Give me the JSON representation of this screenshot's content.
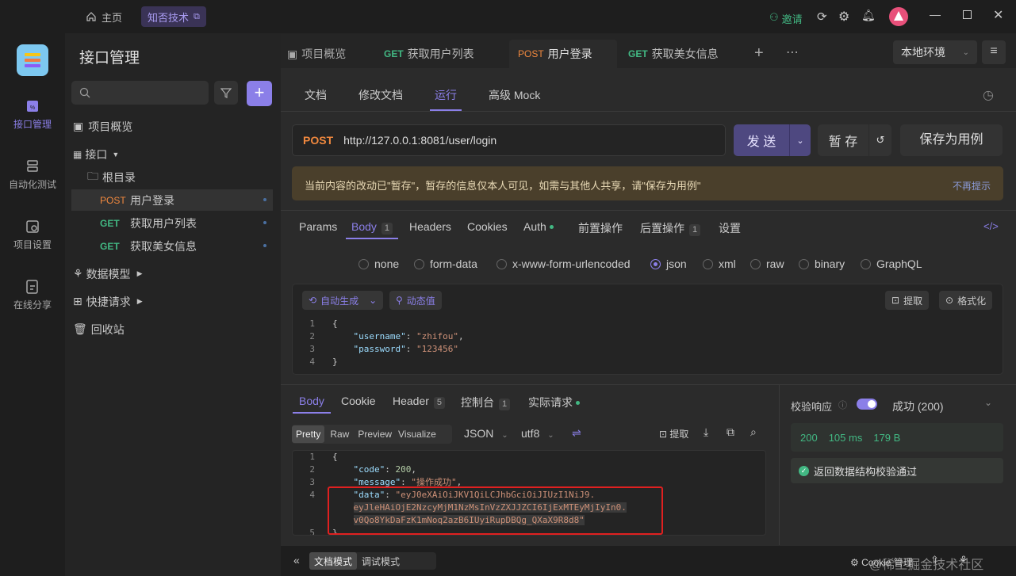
{
  "topbar": {
    "home": "主页",
    "tab": "知否技术",
    "invite": "邀请"
  },
  "rail": [
    "接口管理",
    "自动化测试",
    "项目设置",
    "在线分享"
  ],
  "sidebar": {
    "title": "接口管理",
    "items": [
      {
        "label": "项目概览"
      },
      {
        "label": "接口"
      },
      {
        "label": "根目录"
      },
      {
        "method": "POST",
        "label": "用户登录"
      },
      {
        "method": "GET",
        "label": "获取用户列表"
      },
      {
        "method": "GET",
        "label": "获取美女信息"
      },
      {
        "label": "数据模型"
      },
      {
        "label": "快捷请求"
      },
      {
        "label": "回收站"
      }
    ]
  },
  "tabs": [
    {
      "label": "项目概览"
    },
    {
      "method": "GET",
      "label": "获取用户列表"
    },
    {
      "method": "POST",
      "label": "用户登录"
    },
    {
      "method": "GET",
      "label": "获取美女信息"
    }
  ],
  "env": "本地环境",
  "subtabs": [
    "文档",
    "修改文档",
    "运行",
    "高级 Mock"
  ],
  "request": {
    "method": "POST",
    "url": "http://127.0.0.1:8081/user/login",
    "send": "发 送",
    "save": "暂 存",
    "save_case": "保存为用例"
  },
  "notice": {
    "text": "当前内容的改动已\"暂存\"，暂存的信息仅本人可见，如需与其他人共享，请\"保存为用例\"",
    "dismiss": "不再提示"
  },
  "param_tabs": {
    "params": "Params",
    "body": "Body",
    "body_count": "1",
    "headers": "Headers",
    "cookies": "Cookies",
    "auth": "Auth",
    "pre": "前置操作",
    "post": "后置操作",
    "post_count": "1",
    "settings": "设置"
  },
  "body_types": [
    "none",
    "form-data",
    "x-www-form-urlencoded",
    "json",
    "xml",
    "raw",
    "binary",
    "GraphQL"
  ],
  "editor": {
    "autogen": "自动生成",
    "dynamic": "动态值",
    "extract": "提取",
    "format": "格式化"
  },
  "request_body": {
    "l2k": "\"username\"",
    "l2v": "\"zhifou\"",
    "l3k": "\"password\"",
    "l3v": "\"123456\""
  },
  "resp_tabs": {
    "body": "Body",
    "cookie": "Cookie",
    "header": "Header",
    "header_count": "5",
    "console": "控制台",
    "console_count": "1",
    "actual": "实际请求"
  },
  "resp_toolbar": {
    "pretty": "Pretty",
    "raw": "Raw",
    "preview": "Preview",
    "visualize": "Visualize",
    "format": "JSON",
    "encoding": "utf8",
    "extract": "提取"
  },
  "response_body": {
    "code_k": "\"code\"",
    "code_v": "200",
    "msg_k": "\"message\"",
    "msg_v": "\"操作成功\"",
    "data_k": "\"data\"",
    "data_1": "\"eyJ0eXAiOiJKV1QiLCJhbGciOiJIUzI1NiJ9.",
    "data_2": "eyJleHAiOjE2NzcyMjM1NzMsInVzZXJJZCI6IjExMTEyMjIyIn0.",
    "data_3": "v0Qo8YkDaFzK1mNoq2azB6IUyiRupDBQg_QXaX9R8d8\""
  },
  "validate": {
    "label": "校验响应",
    "result": "成功 (200)",
    "status": "200",
    "time": "105 ms",
    "size": "179 B",
    "ok": "返回数据结构校验通过"
  },
  "bottom": {
    "doc_mode": "文档模式",
    "debug_mode": "调试模式",
    "cookie": "Cookie 管理",
    "watermark": "@稀土掘金技术社区"
  },
  "colors": {
    "accent": "#8b7fe8",
    "post": "#f0883e",
    "get": "#42b883",
    "highlight_box": "#e02020"
  }
}
